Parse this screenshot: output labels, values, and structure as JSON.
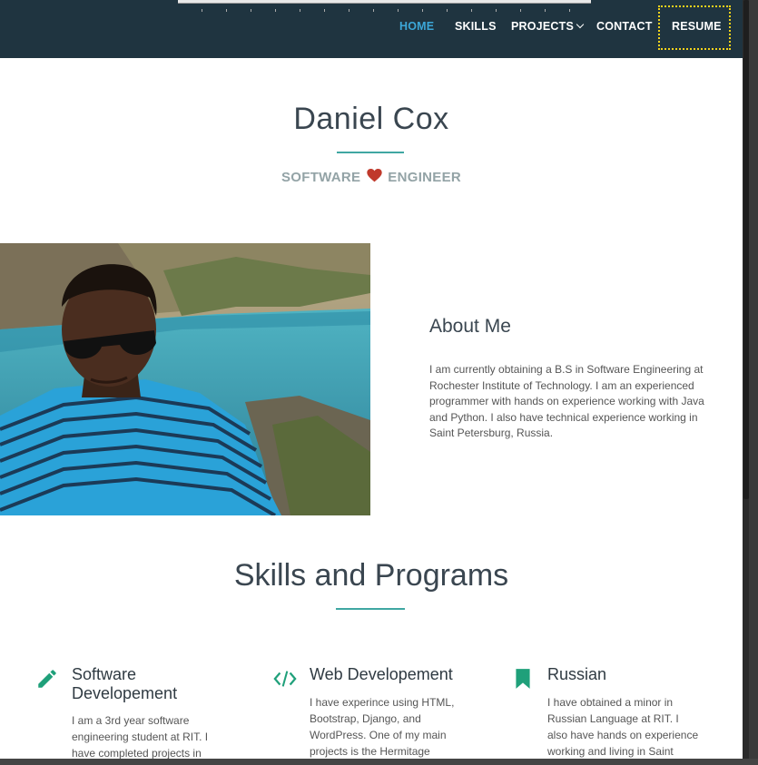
{
  "nav": {
    "items": [
      "HOME",
      "SKILLS",
      "PROJECTS",
      "CONTACT",
      "RESUME"
    ],
    "active": "HOME"
  },
  "hero": {
    "name": "Daniel Cox",
    "subtitle_left": "SOFTWARE",
    "subtitle_right": "ENGINEER"
  },
  "about": {
    "title": "About Me",
    "text": "I am currently obtaining a B.S in Software Engineering at Rochester Institute of Technology. I am an experienced programmer with hands on experience working with Java and Python. I also have technical experience working in Saint Petersburg, Russia."
  },
  "skills": {
    "title": "Skills and Programs",
    "items": [
      {
        "icon": "pencil-icon",
        "title": "Software Developement",
        "text": "I am a 3rd year software engineering student at RIT. I have completed projects in"
      },
      {
        "icon": "code-icon",
        "title": "Web Developement",
        "text": "I have experince using HTML, Bootstrap, Django, and WordPress. One of my main projects is the Hermitage"
      },
      {
        "icon": "bookmark-icon",
        "title": "Russian",
        "text": "I have obtained a minor in Russian Language at RIT. I also have hands on experience working and living in Saint"
      }
    ]
  },
  "colors": {
    "navbar": "#1f3440",
    "accent": "#3fa7a2",
    "nav_active": "#3ca7d8",
    "heart": "#c0392b",
    "icon": "#1fa07a"
  }
}
